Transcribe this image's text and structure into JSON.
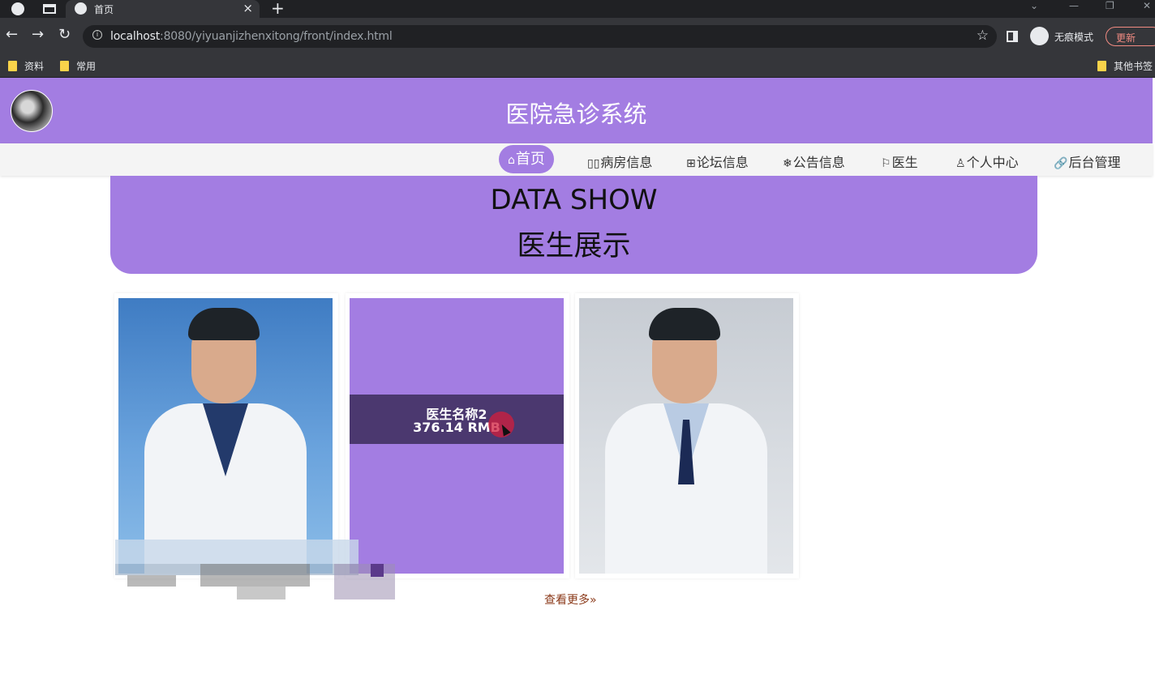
{
  "browser": {
    "tab_title": "首页",
    "url_host": "localhost",
    "url_rest": ":8080/yiyuanjizhenxitong/front/index.html",
    "incognito_label": "无痕模式",
    "update_label": "更新",
    "bookmarks": [
      "资料",
      "常用"
    ],
    "other_bookmarks": "其他书签"
  },
  "site": {
    "title": "医院急诊系统"
  },
  "nav": {
    "items": [
      {
        "icon": "⌂",
        "label": "首页",
        "active": true
      },
      {
        "icon": "▯▯",
        "label": "病房信息"
      },
      {
        "icon": "⊞",
        "label": "论坛信息"
      },
      {
        "icon": "❄",
        "label": "公告信息"
      },
      {
        "icon": "⚐",
        "label": "医生"
      },
      {
        "icon": "♙",
        "label": "个人中心"
      },
      {
        "icon": "🔗",
        "label": "后台管理"
      }
    ]
  },
  "section": {
    "title_en": "DATA SHOW",
    "title_cn": "医生展示"
  },
  "doctors": [
    {
      "name": "",
      "price": ""
    },
    {
      "name": "医生名称2",
      "price": "376.14 RMB"
    },
    {
      "name": "",
      "price": ""
    }
  ],
  "more_label": "查看更多»",
  "colors": {
    "brand": "#a37de2",
    "overlay": "#3c2c5a",
    "more_link": "#8b3a1a"
  }
}
